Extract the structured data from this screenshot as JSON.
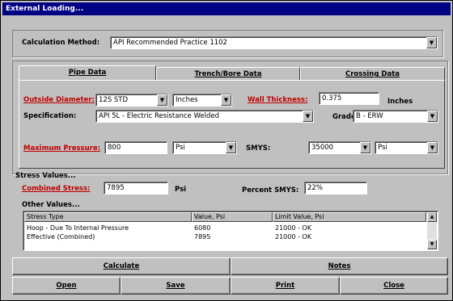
{
  "window": {
    "title": "External Loading..."
  },
  "calc_method": {
    "label": "Calculation Method:",
    "value": "API Recommended Practice 1102"
  },
  "tabs": [
    {
      "label": "Pipe Data",
      "active": true
    },
    {
      "label": "Trench/Bore Data",
      "active": false
    },
    {
      "label": "Crossing Data",
      "active": false
    }
  ],
  "pipe": {
    "od_label": "Outside Diameter:",
    "od_value": "12S STD",
    "od_unit": "Inches",
    "wall_label": "Wall Thickness:",
    "wall_value": "0.375",
    "wall_unit": "Inches",
    "spec_label": "Specification:",
    "spec_value": "API 5L - Electric Resistance Welded",
    "grade_label": "Grade:",
    "grade_value": "B - ERW",
    "maxp_label": "Maximum Pressure:",
    "maxp_value": "800",
    "maxp_unit": "Psi",
    "smys_label": "SMYS:",
    "smys_value": "35000",
    "smys_unit": "Psi"
  },
  "stress": {
    "section_label": "Stress Values...",
    "combined_label": "Combined Stress:",
    "combined_value": "7895",
    "combined_unit": "Psi",
    "pct_label": "Percent SMYS:",
    "pct_value": "22%",
    "other_label": "Other Values..."
  },
  "table": {
    "headers": [
      "Stress Type",
      "Value, Psi",
      "Limit Value, Psi"
    ],
    "rows": [
      [
        "Hoop - Due To Internal Pressure",
        "6080",
        "21000 - OK"
      ],
      [
        "Effective (Combined)",
        "7895",
        "21000 - OK"
      ]
    ]
  },
  "buttons": {
    "calculate": "Calculate",
    "notes": "Notes",
    "open": "Open",
    "save": "Save",
    "print": "Print",
    "close": "Close"
  }
}
